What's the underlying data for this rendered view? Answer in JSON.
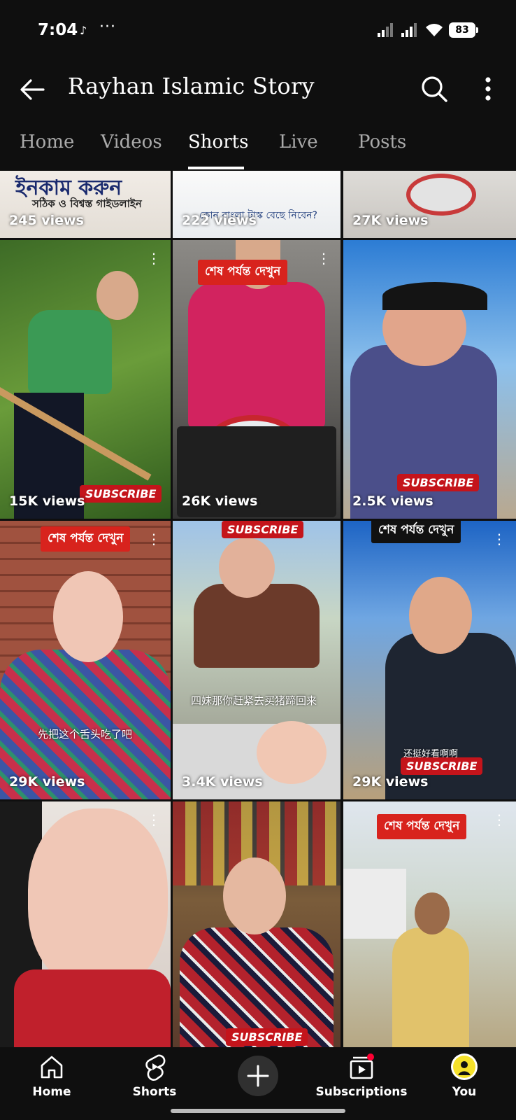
{
  "status_bar": {
    "time": "7:04",
    "tiktok_glyph": "♪",
    "dots": "···",
    "battery": "83"
  },
  "header": {
    "title": "Rayhan Islamic Story"
  },
  "tabs": [
    {
      "label": "Home",
      "active": false
    },
    {
      "label": "Videos",
      "active": false
    },
    {
      "label": "Shorts",
      "active": true
    },
    {
      "label": "Live",
      "active": false
    },
    {
      "label": "Posts",
      "active": false
    }
  ],
  "shorts": [
    {
      "views": "245 views",
      "overlay_title": "ইনকাম করুন",
      "overlay_sub": "সঠিক ও বিশ্বস্ত গাইডলাইন"
    },
    {
      "views": "222 views",
      "overlay_text": "কোন বাংলা টাস্ক বেছে নিবেন?"
    },
    {
      "views": "27K views"
    },
    {
      "views": "15K views",
      "badge": "SUBSCRIBE"
    },
    {
      "views": "26K views",
      "badge": "শেষ পর্যন্ত দেখুন"
    },
    {
      "views": "2.5K views",
      "badge": "SUBSCRIBE"
    },
    {
      "views": "29K views",
      "badge": "শেষ পর্যন্ত দেখুন",
      "caption": "先把这个舌头吃了吧"
    },
    {
      "views": "3.4K views",
      "badge": "SUBSCRIBE",
      "caption": "四妹那你赶紧去买猪蹄回来"
    },
    {
      "views": "29K views",
      "badge": "শেষ পর্যন্ত দেখুন",
      "badge2": "SUBSCRIBE",
      "caption": "还挺好看啊啊"
    },
    {
      "views": ""
    },
    {
      "views": "",
      "badge": "SUBSCRIBE"
    },
    {
      "views": "",
      "badge": "শেষ পর্যন্ত দেখুন"
    }
  ],
  "bottom_nav": {
    "home": "Home",
    "shorts": "Shorts",
    "subscriptions": "Subscriptions",
    "you": "You"
  },
  "colors": {
    "background": "#0f0f0f",
    "badge_red": "#d8231d",
    "inactive_tab": "#aaaaaa"
  },
  "icons": [
    "back-arrow-icon",
    "search-icon",
    "more-vertical-icon",
    "home-icon",
    "shorts-icon",
    "create-plus-icon",
    "subscriptions-icon",
    "avatar-icon"
  ]
}
